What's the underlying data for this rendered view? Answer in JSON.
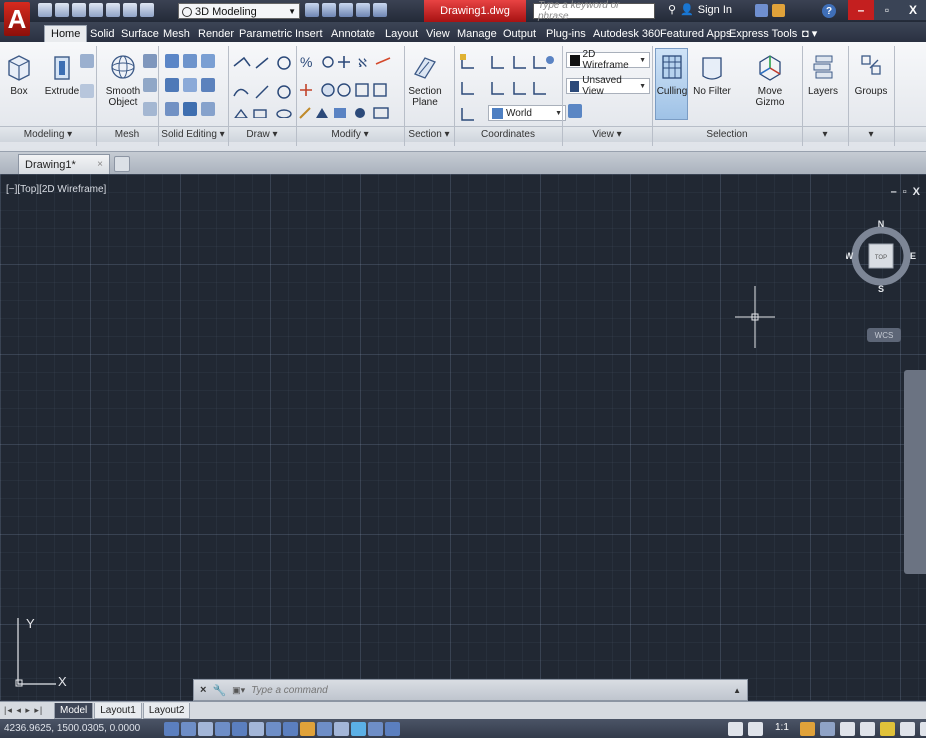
{
  "app": {
    "logo_letter": "A",
    "workspace": "3D Modeling",
    "document_title": "Drawing1.dwg",
    "search_placeholder": "Type a keyword or phrase",
    "sign_in": "Sign In",
    "help": "?"
  },
  "window_controls": {
    "minimize": "–",
    "restore": "▫",
    "close": "X"
  },
  "ribbon_tabs": [
    "Home",
    "Solid",
    "Surface",
    "Mesh",
    "Render",
    "Parametric",
    "Insert",
    "Annotate",
    "Layout",
    "View",
    "Manage",
    "Output",
    "Plug-ins",
    "Autodesk 360",
    "Featured Apps",
    "Express Tools"
  ],
  "ribbon": {
    "buttons": {
      "box": "Box",
      "extrude": "Extrude",
      "smooth_object": "Smooth Object",
      "section_plane": "Section Plane",
      "culling": "Culling",
      "no_filter": "No Filter",
      "move_gizmo": "Move Gizmo",
      "layers": "Layers",
      "groups": "Groups"
    },
    "visual_style": "2D Wireframe",
    "view": "Unsaved View",
    "ucs": "World",
    "panels": [
      "Modeling ▾",
      "Mesh",
      "Solid Editing ▾",
      "Draw ▾",
      "Modify ▾",
      "Section ▾",
      "Coordinates",
      "View ▾",
      "Selection",
      "▾",
      "▾"
    ]
  },
  "file_tab": {
    "name": "Drawing1*",
    "close": "×"
  },
  "viewport": {
    "label": "[−][Top][2D Wireframe]",
    "controls": [
      "–",
      "▫",
      "X"
    ],
    "viewcube": {
      "north": "N",
      "south": "S",
      "east": "E",
      "west": "W",
      "face": "TOP"
    },
    "wcs": "WCS",
    "ucs_x": "X",
    "ucs_y": "Y"
  },
  "command_line": {
    "placeholder": "Type a command",
    "close": "×"
  },
  "layout_tabs": [
    "Model",
    "Layout1",
    "Layout2"
  ],
  "status": {
    "coordinates": "4236.9625, 1500.0305, 0.0000",
    "scale": "1:1"
  },
  "colors": {
    "canvas": "#212833",
    "accent_red": "#c41f1f",
    "title_bar": "#2b3141"
  }
}
